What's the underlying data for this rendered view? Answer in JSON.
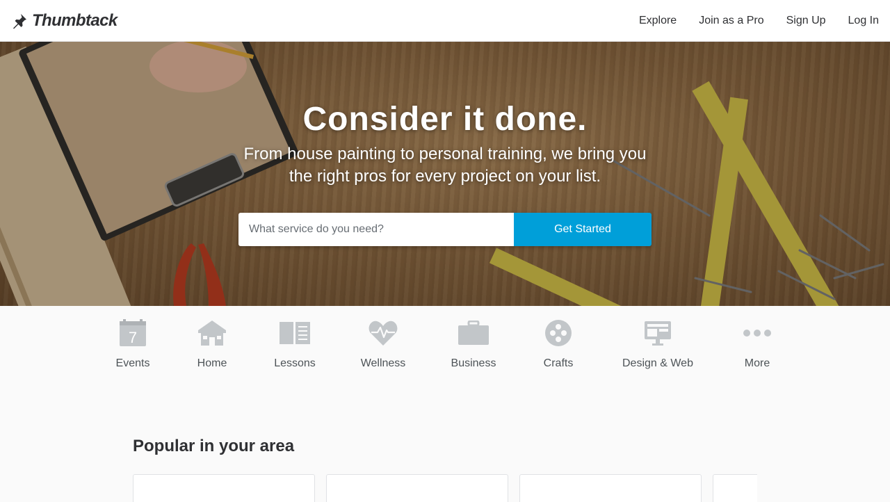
{
  "header": {
    "brand_name": "Thumbtack",
    "nav": [
      "Explore",
      "Join as a Pro",
      "Sign Up",
      "Log In"
    ]
  },
  "hero": {
    "title": "Consider it done.",
    "subtitle": "From house painting to personal training, we bring you the right pros for every project on your list.",
    "search_placeholder": "What service do you need?",
    "search_value": "",
    "cta_label": "Get Started"
  },
  "categories": [
    {
      "label": "Events",
      "icon": "calendar-icon",
      "calendar_day": "7"
    },
    {
      "label": "Home",
      "icon": "house-icon"
    },
    {
      "label": "Lessons",
      "icon": "book-icon"
    },
    {
      "label": "Wellness",
      "icon": "heart-pulse-icon"
    },
    {
      "label": "Business",
      "icon": "briefcase-icon"
    },
    {
      "label": "Crafts",
      "icon": "palette-icon"
    },
    {
      "label": "Design & Web",
      "icon": "monitor-icon"
    },
    {
      "label": "More",
      "icon": "more-dots-icon"
    }
  ],
  "popular": {
    "title": "Popular in your area"
  },
  "colors": {
    "accent": "#009fd9",
    "icon_gray": "#c2c6c9",
    "text_dark": "#2f3033"
  }
}
